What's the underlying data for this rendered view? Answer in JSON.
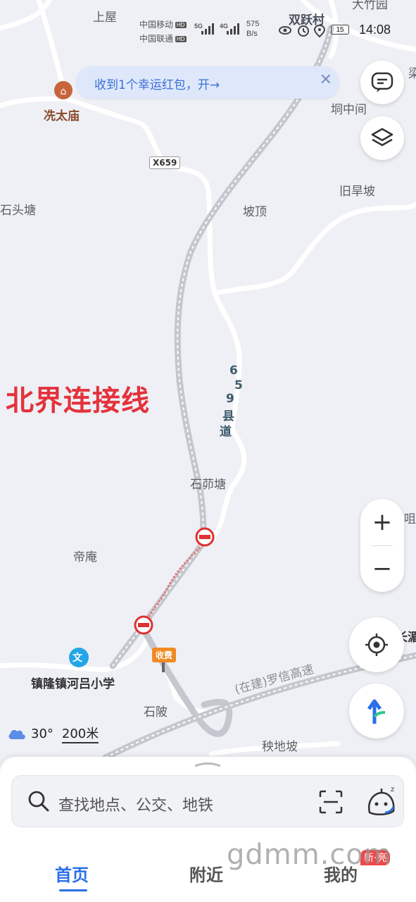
{
  "status_bar": {
    "carrier1": "中国移动",
    "carrier2": "中国联通",
    "hd": "HD",
    "net1": "5G",
    "net2": "4G",
    "speed_value": "575",
    "speed_unit": "B/s",
    "battery": "15",
    "time": "14:08"
  },
  "banner": {
    "text": "收到1个幸运红包，开→",
    "close": "✕"
  },
  "map": {
    "labels": {
      "shangwu": "上屋",
      "shuangyuecun": "双跃村",
      "xiantaimiao": "冼太庙",
      "dongzhongjian": "垌中间",
      "jiuhanpo": "旧旱坡",
      "shitoutang": "石头塘",
      "poding": "坡顶",
      "shiyoutang": "石茆塘",
      "di_an": "帝庵",
      "school": "镇隆镇河吕小学",
      "shiling": "石陂",
      "yangdipo": "秧地坡",
      "expressway": "(在建)罗信高速",
      "edge_top": "大竹园",
      "edge_right1": "梁",
      "edge_right2": "咀",
      "edge_right3": "长湄"
    },
    "road_badge": "X659",
    "county_road": [
      "6",
      "5",
      "9",
      "县",
      "道"
    ],
    "toll": "收费",
    "annotation": "北界连接线",
    "poi_school_icon": "文"
  },
  "weather": {
    "temp": "30°",
    "scale": "200米"
  },
  "search": {
    "placeholder": "查找地点、公交、地铁"
  },
  "tabs": [
    {
      "label": "首页",
      "active": true
    },
    {
      "label": "附近",
      "active": false
    },
    {
      "label": "我的",
      "active": false
    }
  ],
  "watermark": "gdmm.com",
  "badge_new": "新·亮",
  "colors": {
    "accent": "#2a6fe8",
    "annotation": "#e4323c",
    "poi": "#c8643c"
  }
}
